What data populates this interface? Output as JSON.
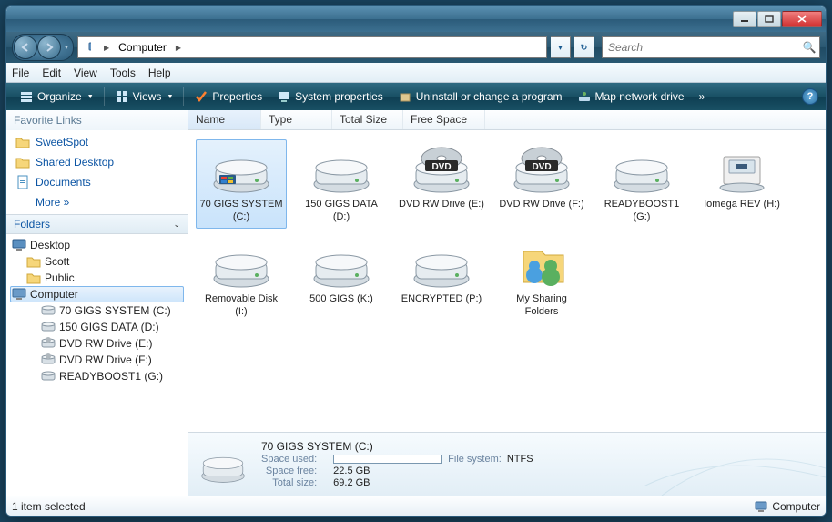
{
  "location": {
    "breadcrumb": "Computer"
  },
  "search": {
    "placeholder": "Search"
  },
  "menu": {
    "file": "File",
    "edit": "Edit",
    "view": "View",
    "tools": "Tools",
    "help": "Help"
  },
  "toolbar": {
    "organize": "Organize",
    "views": "Views",
    "properties": "Properties",
    "system_properties": "System properties",
    "uninstall": "Uninstall or change a program",
    "map_drive": "Map network drive"
  },
  "sidebar": {
    "fav_header": "Favorite Links",
    "links": [
      {
        "label": "SweetSpot"
      },
      {
        "label": "Shared Desktop"
      },
      {
        "label": "Documents"
      },
      {
        "label": "More  »"
      }
    ],
    "folders_header": "Folders",
    "tree": [
      {
        "label": "Desktop",
        "indent": 0,
        "icon": "desktop"
      },
      {
        "label": "Scott",
        "indent": 1,
        "icon": "folder"
      },
      {
        "label": "Public",
        "indent": 1,
        "icon": "folder"
      },
      {
        "label": "Computer",
        "indent": 1,
        "icon": "computer",
        "selected": true
      },
      {
        "label": "70 GIGS SYSTEM (C:)",
        "indent": 2,
        "icon": "hdd"
      },
      {
        "label": "150 GIGS DATA (D:)",
        "indent": 2,
        "icon": "hdd"
      },
      {
        "label": "DVD RW Drive (E:)",
        "indent": 2,
        "icon": "dvd"
      },
      {
        "label": "DVD RW Drive (F:)",
        "indent": 2,
        "icon": "dvd"
      },
      {
        "label": "READYBOOST1 (G:)",
        "indent": 2,
        "icon": "hdd"
      }
    ]
  },
  "columns": {
    "name": "Name",
    "type": "Type",
    "total": "Total Size",
    "free": "Free Space"
  },
  "drives": [
    {
      "label": "70 GIGS SYSTEM (C:)",
      "icon": "hdd-win",
      "selected": true
    },
    {
      "label": "150 GIGS DATA (D:)",
      "icon": "hdd"
    },
    {
      "label": "DVD RW Drive (E:)",
      "icon": "dvd"
    },
    {
      "label": "DVD RW Drive (F:)",
      "icon": "dvd"
    },
    {
      "label": "READYBOOST1 (G:)",
      "icon": "hdd"
    },
    {
      "label": "Iomega REV (H:)",
      "icon": "rev"
    },
    {
      "label": "Removable Disk (I:)",
      "icon": "hdd"
    },
    {
      "label": "500 GIGS (K:)",
      "icon": "hdd"
    },
    {
      "label": "ENCRYPTED (P:)",
      "icon": "hdd"
    },
    {
      "label": "My Sharing Folders",
      "icon": "share"
    }
  ],
  "details": {
    "title": "70 GIGS SYSTEM (C:)",
    "space_used_label": "Space used:",
    "file_system_label": "File system:",
    "file_system": "NTFS",
    "space_free_label": "Space free:",
    "space_free": "22.5 GB",
    "total_size_label": "Total size:",
    "total_size": "69.2 GB"
  },
  "status": {
    "left": "1 item selected",
    "right": "Computer"
  }
}
